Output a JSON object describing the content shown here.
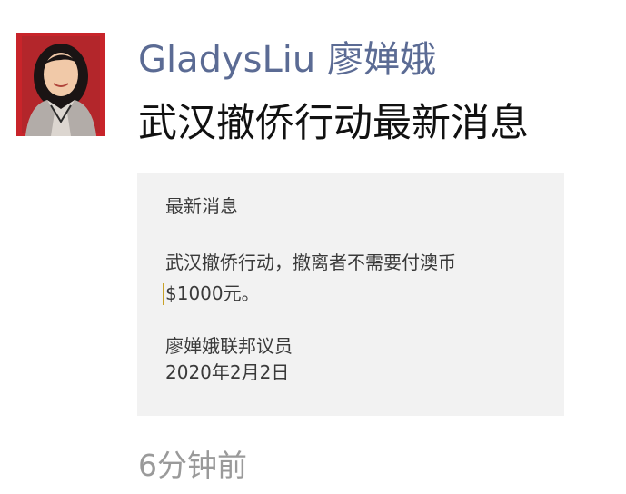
{
  "post": {
    "author": "GladysLiu 廖婵娥",
    "text": "武汉撤侨行动最新消息",
    "timestamp": "6分钟前"
  },
  "card": {
    "lines": [
      "最新消息",
      "武汉撤侨行动，撤离者不需要付澳币",
      "$1000元。",
      "廖婵娥联邦议员",
      "2020年2月2日"
    ]
  },
  "colors": {
    "author_name": "#5b6b94",
    "avatar_background": "#c8242a",
    "card_background": "#f2f2f2",
    "timestamp": "#9a9a9a"
  }
}
